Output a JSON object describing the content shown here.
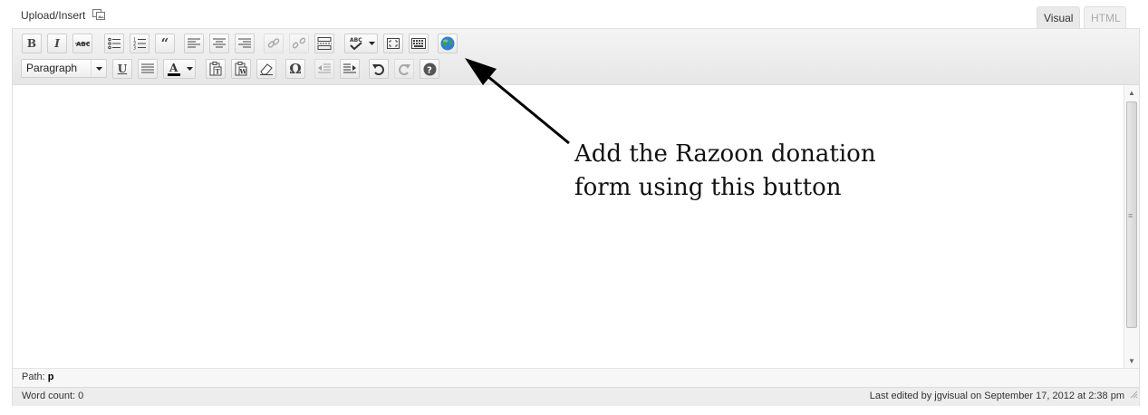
{
  "header": {
    "upload_insert": "Upload/Insert"
  },
  "tabs": [
    {
      "label": "Visual",
      "active": true
    },
    {
      "label": "HTML",
      "active": false
    }
  ],
  "toolbar": {
    "row1": [
      "bold-icon",
      "italic-icon",
      "strikethrough-icon",
      "bullet-list-icon",
      "numbered-list-icon",
      "blockquote-icon",
      "align-left-icon",
      "align-center-icon",
      "align-right-icon",
      "link-icon",
      "unlink-icon",
      "more-tag-icon",
      "spellcheck-icon",
      "fullscreen-icon",
      "kitchen-sink-icon",
      "razoon-globe-icon"
    ],
    "row2": [
      "format-select",
      "underline-icon",
      "justify-icon",
      "text-color-icon",
      "paste-text-icon",
      "paste-word-icon",
      "clear-formatting-icon",
      "special-character-icon",
      "outdent-icon",
      "indent-icon",
      "undo-icon",
      "redo-icon",
      "help-icon"
    ],
    "format_value": "Paragraph"
  },
  "path": {
    "label": "Path:",
    "value": "p"
  },
  "status": {
    "word_count": "Word count: 0",
    "last_edited": "Last edited by jgvisual on September 17, 2012 at 2:38 pm"
  },
  "annotation": {
    "line1": "Add the Razoon donation",
    "line2": "form using this button"
  },
  "colors": {
    "accent": "#21759b",
    "text_color_bar": "#000000"
  }
}
